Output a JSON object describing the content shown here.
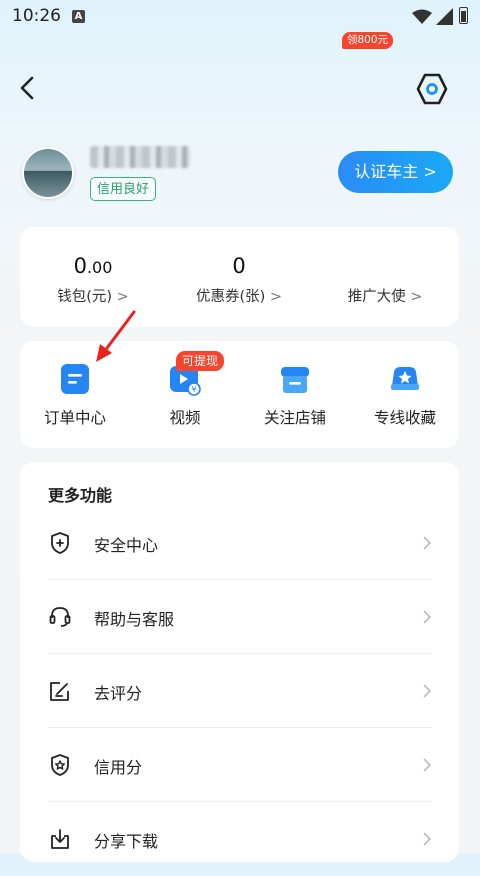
{
  "status_bar": {
    "time": "10:26",
    "app_icon_letter": "A"
  },
  "header": {
    "back_icon": "chevron-left-icon",
    "settings_icon": "hexagon-settings-icon"
  },
  "profile": {
    "credit_badge": "信用良好",
    "verify_button": "认证车主 >",
    "brand_color": "#1aa0f5"
  },
  "stats": [
    {
      "value_int": "0",
      "value_dec": ".00",
      "label": "钱包(元)"
    },
    {
      "value_int": "0",
      "value_dec": "",
      "label": "优惠券(张)"
    },
    {
      "value_int": "",
      "value_dec": "",
      "label": "推广大使",
      "badge": "领800元"
    }
  ],
  "quick_actions": [
    {
      "label": "订单中心",
      "icon": "order-list-icon"
    },
    {
      "label": "视频",
      "icon": "video-coin-icon",
      "badge": "可提现"
    },
    {
      "label": "关注店铺",
      "icon": "store-icon"
    },
    {
      "label": "专线收藏",
      "icon": "truck-star-icon"
    }
  ],
  "more": {
    "title": "更多功能",
    "items": [
      {
        "label": "安全中心",
        "icon": "shield-plus-icon"
      },
      {
        "label": "帮助与客服",
        "icon": "headset-icon"
      },
      {
        "label": "去评分",
        "icon": "edit-note-icon"
      },
      {
        "label": "信用分",
        "icon": "shield-star-icon"
      },
      {
        "label": "分享下载",
        "icon": "download-icon"
      }
    ]
  },
  "chevron": ">"
}
